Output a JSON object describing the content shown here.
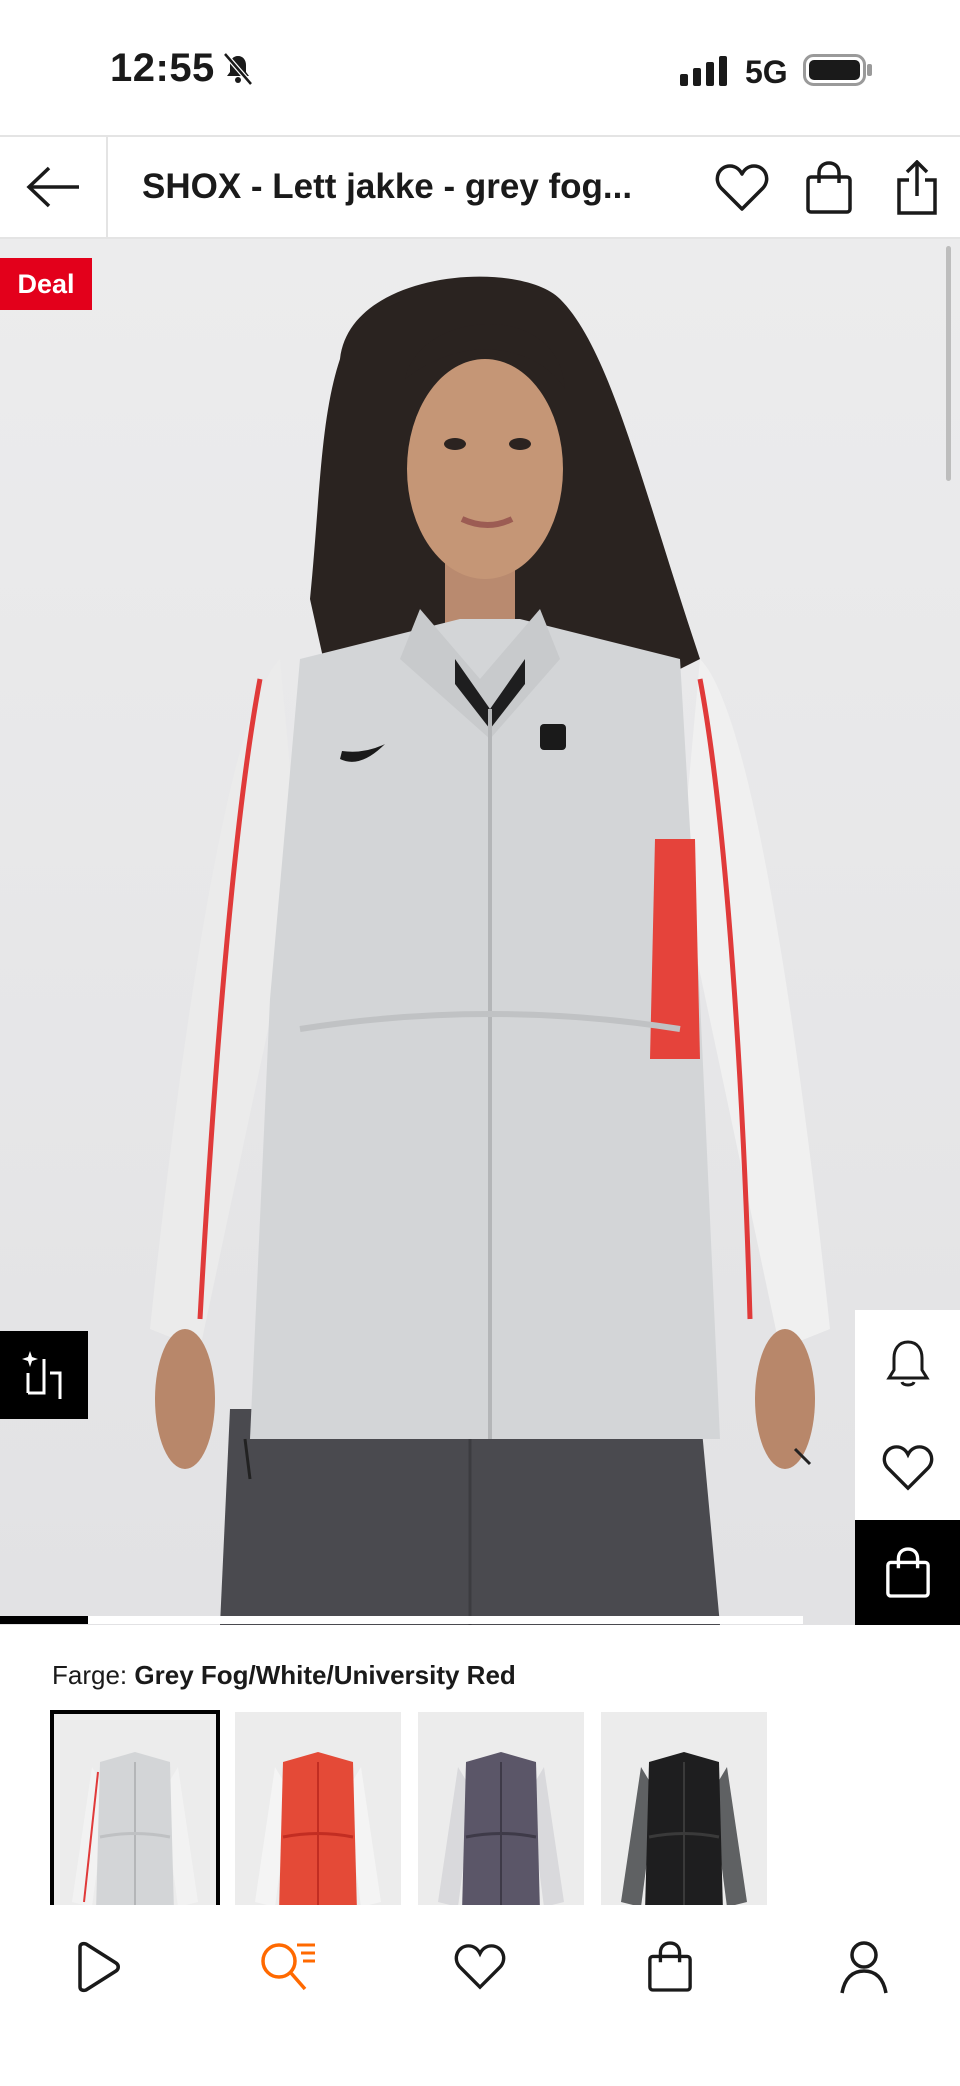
{
  "status_bar": {
    "time": "12:55",
    "network": "5G",
    "icons": [
      "bell-slash-icon",
      "cellular-signal-icon",
      "battery-icon"
    ]
  },
  "header": {
    "title": "SHOX - Lett jakke - grey fog...",
    "icons": [
      "back-arrow-icon",
      "heart-icon",
      "shopping-bag-icon",
      "share-icon"
    ]
  },
  "product_image": {
    "deal_badge": "Deal",
    "side_actions": [
      "bell-icon",
      "heart-icon",
      "shopping-bag-icon"
    ],
    "compare_icon": "sparkle-crop-icon",
    "carousel_progress": 0.11
  },
  "color": {
    "label": "Farge:",
    "value": "Grey Fog/White/University Red",
    "swatches": [
      {
        "name": "Grey Fog/White/University Red",
        "body": "#d3d5d7",
        "sleeve": "#f2f2f2",
        "accent": "#e03a3a"
      },
      {
        "name": "Red",
        "body": "#e44a37",
        "sleeve": "#f4f4f4",
        "accent": "#c22d22"
      },
      {
        "name": "Purple",
        "body": "#5b5668",
        "sleeve": "#d9d9dc",
        "accent": "#3e3a48"
      },
      {
        "name": "Black",
        "body": "#1e1e1f",
        "sleeve": "#5f6163",
        "accent": "#3a3a3a"
      }
    ]
  },
  "bottom_nav": {
    "items": [
      {
        "icon": "play-icon",
        "active": false
      },
      {
        "icon": "search-list-icon",
        "active": true
      },
      {
        "icon": "heart-icon",
        "active": false
      },
      {
        "icon": "shopping-bag-icon",
        "active": false
      },
      {
        "icon": "user-icon",
        "active": false
      }
    ],
    "active_color": "#ff6900"
  },
  "colors": {
    "deal": "#e3001b",
    "text": "#1a1a1a"
  }
}
